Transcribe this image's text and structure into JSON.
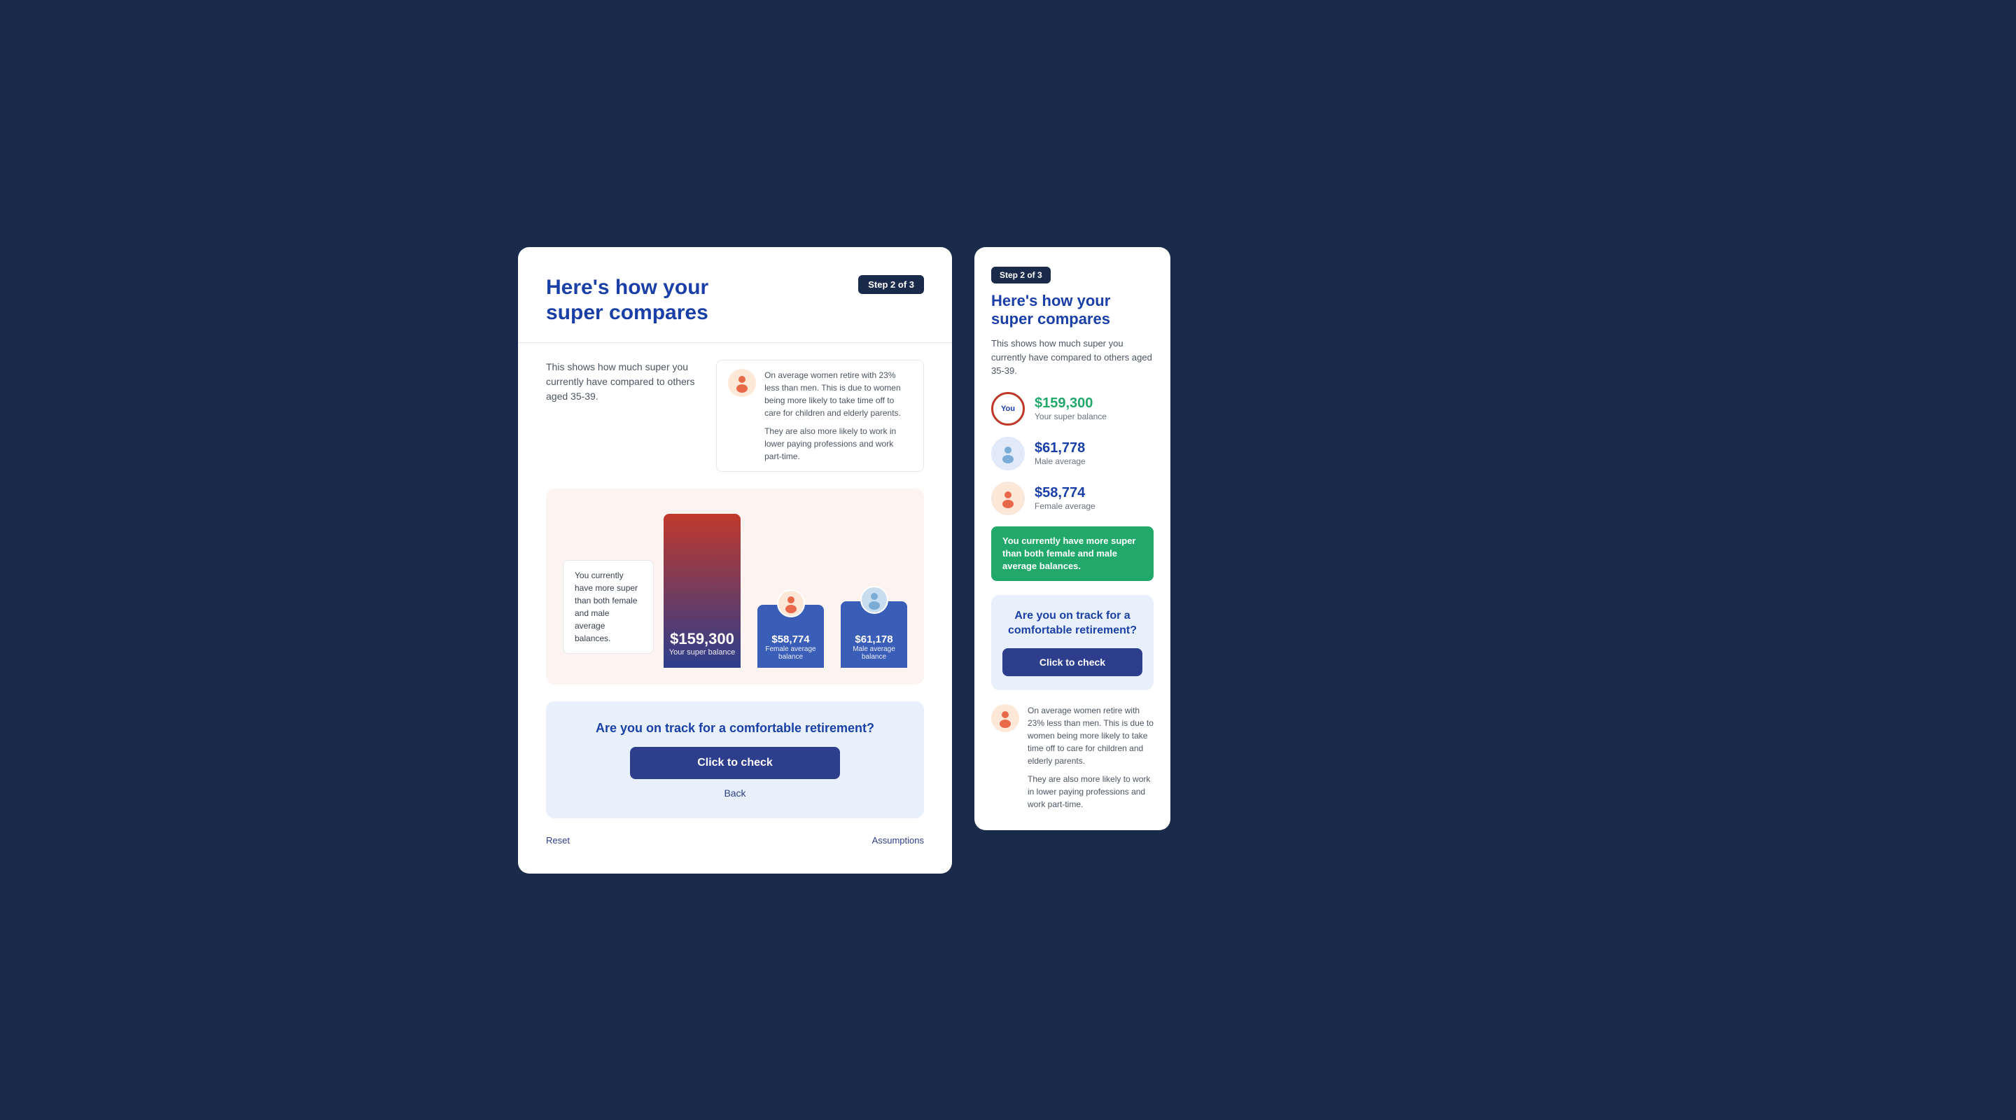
{
  "left_card": {
    "title_line1": "Here's how your",
    "title_line2": "super compares",
    "step_badge": "Step 2 of 3",
    "description": "This shows how much super you currently have compared to others aged 35-39.",
    "info_box_text_1": "On average women retire with 23% less than men. This is due to women being more likely to take time off to care for children and elderly parents.",
    "info_box_text_2": "They are also more likely to work in lower paying professions and work part-time.",
    "chart": {
      "callout": "You currently have more super than both female and male average balances.",
      "you_amount": "$159,300",
      "you_label": "Your super balance",
      "female_amount": "$58,774",
      "female_label": "Female average balance",
      "male_amount": "$61,178",
      "male_label": "Male average balance"
    },
    "cta_question": "Are you on track for a comfortable retirement?",
    "cta_button": "Click to check",
    "back_link": "Back",
    "footer_reset": "Reset",
    "footer_assumptions": "Assumptions"
  },
  "right_card": {
    "step_badge": "Step 2 of 3",
    "title_line1": "Here's how your",
    "title_line2": "super compares",
    "description": "This shows how much super you currently have compared to others aged 35-39.",
    "you_amount": "$159,300",
    "you_label": "Your super balance",
    "male_amount": "$61,778",
    "male_label": "Male average",
    "female_amount": "$58,774",
    "female_label": "Female average",
    "green_notice": "You currently have more super than both female and male average balances.",
    "cta_question": "Are you on track for a comfortable retirement?",
    "cta_button": "Click to check",
    "info_text_1": "On average women retire with 23% less than men. This is due to women being more likely to take time off to care for children and elderly parents.",
    "info_text_2": "They are also more likely to work in lower paying professions and work part-time."
  }
}
